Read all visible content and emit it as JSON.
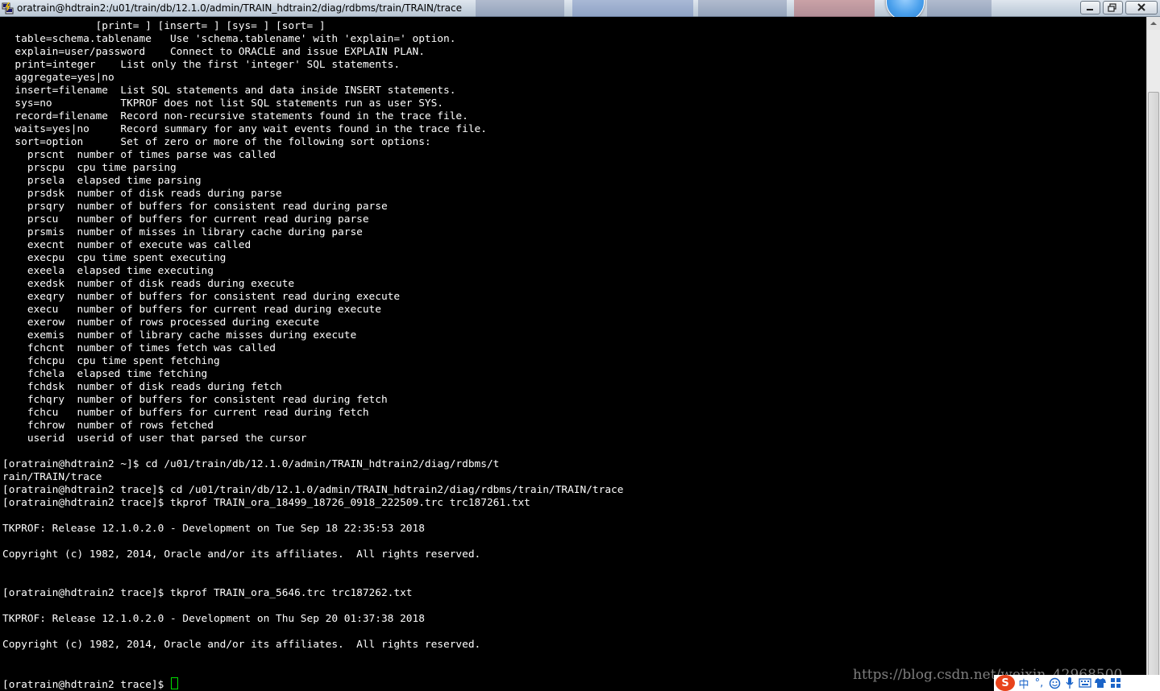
{
  "window": {
    "title": "oratrain@hdtrain2:/u01/train/db/12.1.0/admin/TRAIN_hdtrain2/diag/rdbms/train/TRAIN/trace"
  },
  "terminal": {
    "lines": [
      "               [print= ] [insert= ] [sys= ] [sort= ]",
      "  table=schema.tablename   Use 'schema.tablename' with 'explain=' option.",
      "  explain=user/password    Connect to ORACLE and issue EXPLAIN PLAN.",
      "  print=integer    List only the first 'integer' SQL statements.",
      "  aggregate=yes|no",
      "  insert=filename  List SQL statements and data inside INSERT statements.",
      "  sys=no           TKPROF does not list SQL statements run as user SYS.",
      "  record=filename  Record non-recursive statements found in the trace file.",
      "  waits=yes|no     Record summary for any wait events found in the trace file.",
      "  sort=option      Set of zero or more of the following sort options:",
      "    prscnt  number of times parse was called",
      "    prscpu  cpu time parsing",
      "    prsela  elapsed time parsing",
      "    prsdsk  number of disk reads during parse",
      "    prsqry  number of buffers for consistent read during parse",
      "    prscu   number of buffers for current read during parse",
      "    prsmis  number of misses in library cache during parse",
      "    execnt  number of execute was called",
      "    execpu  cpu time spent executing",
      "    exeela  elapsed time executing",
      "    exedsk  number of disk reads during execute",
      "    exeqry  number of buffers for consistent read during execute",
      "    execu   number of buffers for current read during execute",
      "    exerow  number of rows processed during execute",
      "    exemis  number of library cache misses during execute",
      "    fchcnt  number of times fetch was called",
      "    fchcpu  cpu time spent fetching",
      "    fchela  elapsed time fetching",
      "    fchdsk  number of disk reads during fetch",
      "    fchqry  number of buffers for consistent read during fetch",
      "    fchcu   number of buffers for current read during fetch",
      "    fchrow  number of rows fetched",
      "    userid  userid of user that parsed the cursor",
      "",
      "[oratrain@hdtrain2 ~]$ cd /u01/train/db/12.1.0/admin/TRAIN_hdtrain2/diag/rdbms/t",
      "rain/TRAIN/trace",
      "[oratrain@hdtrain2 trace]$ cd /u01/train/db/12.1.0/admin/TRAIN_hdtrain2/diag/rdbms/train/TRAIN/trace",
      "[oratrain@hdtrain2 trace]$ tkprof TRAIN_ora_18499_18726_0918_222509.trc trc187261.txt",
      "",
      "TKPROF: Release 12.1.0.2.0 - Development on Tue Sep 18 22:35:53 2018",
      "",
      "Copyright (c) 1982, 2014, Oracle and/or its affiliates.  All rights reserved.",
      "",
      "",
      "[oratrain@hdtrain2 trace]$ tkprof TRAIN_ora_5646.trc trc187262.txt",
      "",
      "TKPROF: Release 12.1.0.2.0 - Development on Thu Sep 20 01:37:38 2018",
      "",
      "Copyright (c) 1982, 2014, Oracle and/or its affiliates.  All rights reserved.",
      ""
    ],
    "prompt": "[oratrain@hdtrain2 trace]$ "
  },
  "overlay": {
    "watermark": "https://blog.csdn.net/weixin_42968500",
    "ime_logo": "S",
    "ime_lang": "中",
    "ime_punct": "°,"
  },
  "icons": {
    "app": "putty-icon",
    "minimize": "minimize-icon",
    "maximize": "maximize-icon",
    "close": "close-icon",
    "scroll_up": "arrow-up-icon",
    "scroll_down": "arrow-down-icon"
  },
  "colors": {
    "terminal_bg": "#000000",
    "terminal_fg": "#ffffff",
    "cursor": "#00e000",
    "ime_logo": "#e8431b"
  }
}
